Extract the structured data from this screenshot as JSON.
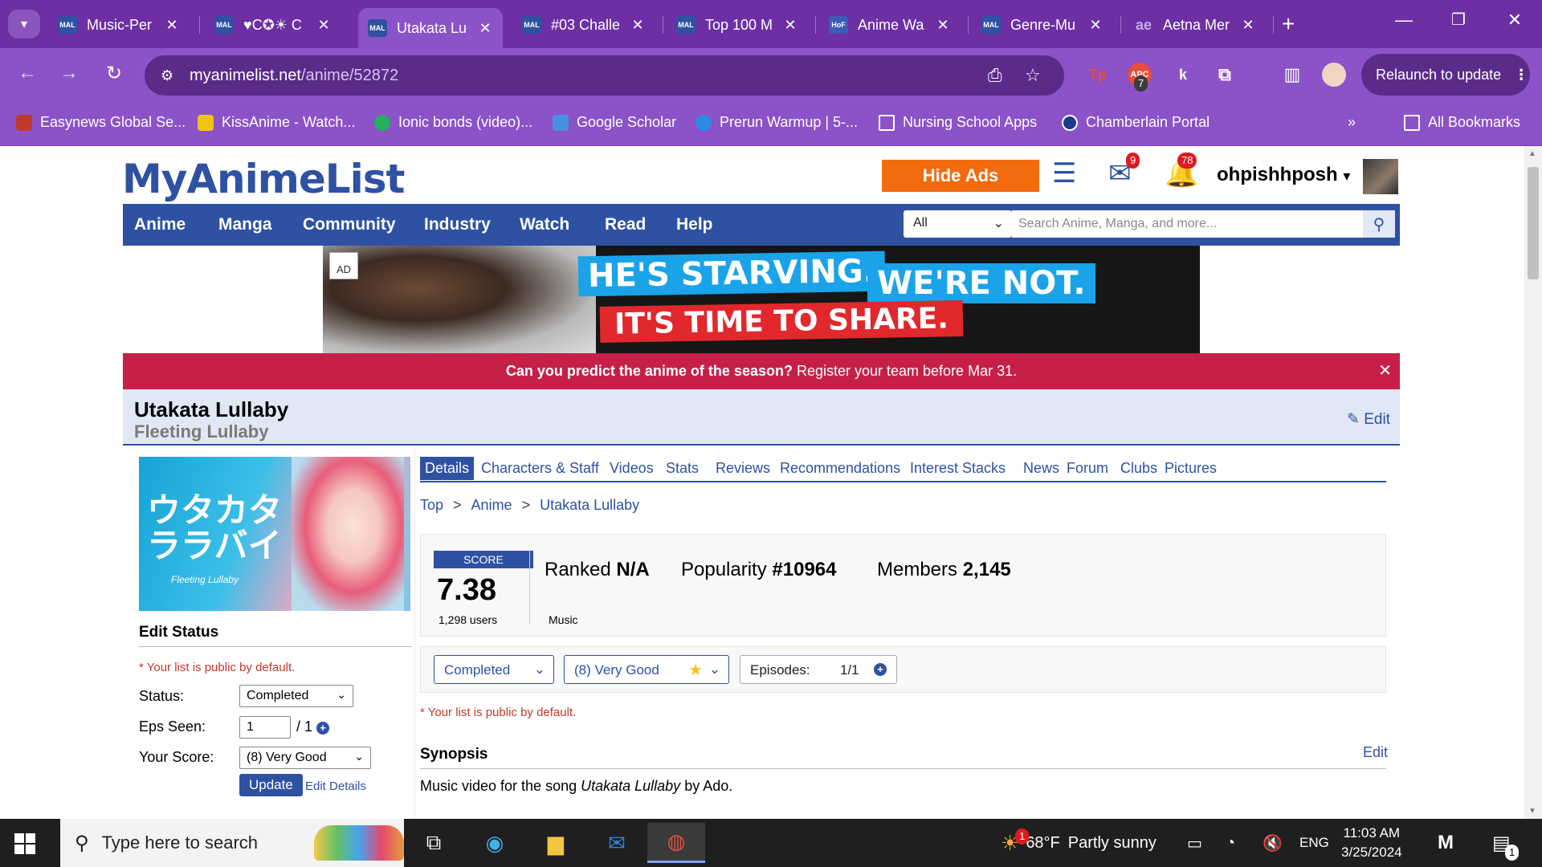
{
  "browser": {
    "tabs": [
      {
        "favicon": "MAL",
        "label": "Music-Per"
      },
      {
        "favicon": "MAL",
        "label": "♥C✪☀ C"
      },
      {
        "favicon": "MAL",
        "label": "Utakata Lu",
        "active": true
      },
      {
        "favicon": "MAL",
        "label": "#03 Challe"
      },
      {
        "favicon": "MAL",
        "label": "Top 100 M"
      },
      {
        "favicon": "HoF",
        "label": "Anime Wa"
      },
      {
        "favicon": "MAL",
        "label": "Genre-Mu"
      },
      {
        "favicon": "ae",
        "label": "Aetna Mer"
      }
    ],
    "url_host": "myanimelist.net",
    "url_path": "/anime/52872",
    "relaunch_label": "Relaunch to update",
    "ext_badge": "7",
    "bookmarks": [
      {
        "label": "Easynews Global Se...",
        "color": "#c0392b"
      },
      {
        "label": "KissAnime - Watch...",
        "color": "#f1c40f"
      },
      {
        "label": "Ionic bonds (video)...",
        "color": "#27ae60"
      },
      {
        "label": "Google Scholar",
        "color": "#4a90e2"
      },
      {
        "label": "Prerun Warmup | 5-...",
        "color": "#2d8ae0"
      },
      {
        "label": "Nursing School Apps",
        "color": "folder"
      },
      {
        "label": "Chamberlain Portal",
        "color": "#1b3a8c"
      }
    ],
    "all_bookmarks": "All Bookmarks"
  },
  "site": {
    "logo": "MyAnimeList",
    "hide_ads": "Hide Ads",
    "mail_badge": "9",
    "notif_badge": "78",
    "username": "ohpishhposh",
    "nav": [
      "Anime",
      "Manga",
      "Community",
      "Industry",
      "Watch",
      "Read",
      "Help"
    ],
    "search_category": "All",
    "search_placeholder": "Search Anime, Manga, and more..."
  },
  "ad": {
    "tag": "AD",
    "line1a": "HE'S STARVING.",
    "line1b": "WE'RE NOT.",
    "line2": "IT'S TIME TO SHARE."
  },
  "announcement": {
    "question": "Can you predict the anime of the season?",
    "rest": " Register your team before Mar 31."
  },
  "anime": {
    "title": "Utakata Lullaby",
    "title_en": "Fleeting Lullaby",
    "edit": "Edit",
    "cover_jp": "ウタカタララバイ",
    "cover_en": "Fleeting Lullaby"
  },
  "edit_status": {
    "title": "Edit Status",
    "note": "* Your list is public by default.",
    "status_label": "Status:",
    "status_value": "Completed",
    "eps_label": "Eps Seen:",
    "eps_value": "1",
    "eps_total": "/ 1",
    "score_label": "Your Score:",
    "score_value": "(8) Very Good",
    "update": "Update",
    "edit_details": "Edit Details"
  },
  "subtabs": [
    "Details",
    "Characters & Staff",
    "Videos",
    "Stats",
    "Reviews",
    "Recommendations",
    "Interest Stacks",
    "News",
    "Forum",
    "Clubs",
    "Pictures"
  ],
  "breadcrumb": [
    "Top",
    "Anime",
    "Utakata Lullaby"
  ],
  "stats": {
    "score_label": "SCORE",
    "score": "7.38",
    "score_users": "1,298 users",
    "ranked_label": "Ranked",
    "ranked": "N/A",
    "popularity_label": "Popularity",
    "popularity": "#10964",
    "members_label": "Members",
    "members": "2,145",
    "type": "Music"
  },
  "listbar": {
    "status": "Completed",
    "score": "(8) Very Good",
    "episodes_label": "Episodes:",
    "episodes": "1/1",
    "note": "* Your list is public by default."
  },
  "synopsis": {
    "title": "Synopsis",
    "edit": "Edit",
    "pre": "Music video for the song ",
    "song": "Utakata Lullaby",
    "post": " by Ado."
  },
  "taskbar": {
    "search_placeholder": "Type here to search",
    "weather_temp": "68°F",
    "weather_desc": "Partly sunny",
    "weather_badge": "1",
    "lang": "ENG",
    "time": "11:03 AM",
    "date": "3/25/2024",
    "notif_badge": "1"
  },
  "colors": {
    "chrome_purple": "#6d2fa3",
    "mal_blue": "#2e51a2",
    "hide_ads_orange": "#f26b0f",
    "announce_red": "#c62048"
  }
}
